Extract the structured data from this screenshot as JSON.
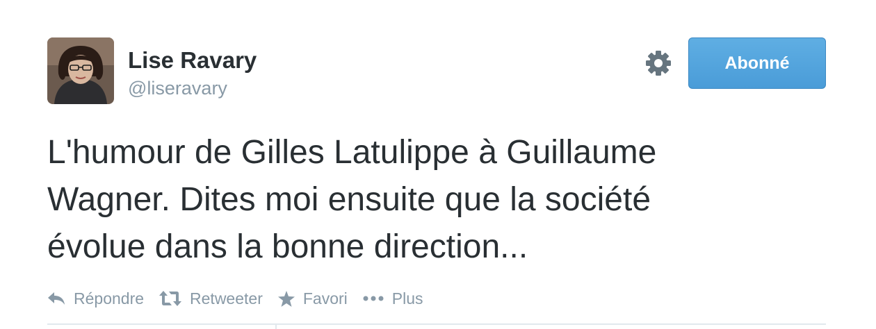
{
  "user": {
    "name": "Lise Ravary",
    "handle": "@liseravary"
  },
  "follow_button": {
    "label": "Abonné"
  },
  "settings_icon": "gear-icon",
  "tweet": {
    "lines": [
      "L'humour de Gilles Latulippe à Guillaume",
      "Wagner. Dites moi ensuite que la société",
      "évolue dans la bonne direction..."
    ]
  },
  "actions": [
    {
      "label": "Répondre",
      "icon": "reply-icon"
    },
    {
      "label": "Retweeter",
      "icon": "retweet-icon"
    },
    {
      "label": "Favori",
      "icon": "star-icon"
    },
    {
      "label": "Plus",
      "icon": "more-icon"
    }
  ],
  "colors": {
    "accent": "#4a9cd8",
    "muted": "#8899a6",
    "text": "#292f33"
  }
}
